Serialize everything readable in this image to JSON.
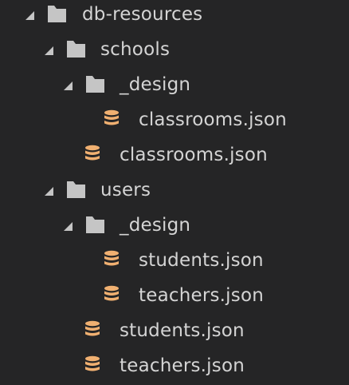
{
  "explorer": {
    "root": {
      "label": "db-resources",
      "icon": "folder-icon",
      "expanded": true
    },
    "items": [
      {
        "label": "schools",
        "type": "folder",
        "icon": "folder-icon",
        "expanded": true
      },
      {
        "label": "_design",
        "type": "folder",
        "icon": "folder-icon",
        "expanded": true
      },
      {
        "label": "classrooms.json",
        "type": "file",
        "icon": "database-icon"
      },
      {
        "label": "classrooms.json",
        "type": "file",
        "icon": "database-icon"
      },
      {
        "label": "users",
        "type": "folder",
        "icon": "folder-icon",
        "expanded": true
      },
      {
        "label": "_design",
        "type": "folder",
        "icon": "folder-icon",
        "expanded": true
      },
      {
        "label": "students.json",
        "type": "file",
        "icon": "database-icon"
      },
      {
        "label": "teachers.json",
        "type": "file",
        "icon": "database-icon"
      },
      {
        "label": "students.json",
        "type": "file",
        "icon": "database-icon"
      },
      {
        "label": "teachers.json",
        "type": "file",
        "icon": "database-icon"
      }
    ]
  },
  "colors": {
    "background": "#252526",
    "text": "#d4d4d4",
    "folder": "#c5c5c5",
    "database": "#f0b071"
  }
}
